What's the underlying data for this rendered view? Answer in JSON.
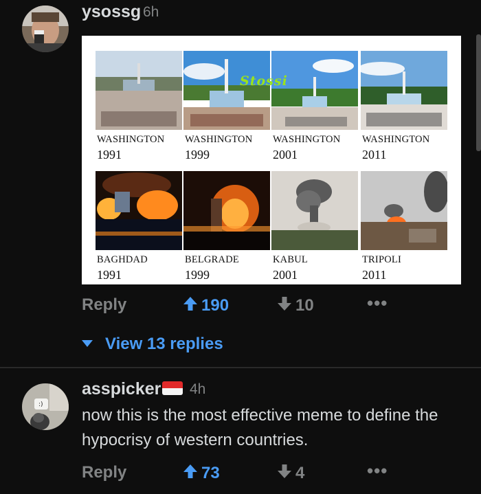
{
  "comments": [
    {
      "username": "ysossg",
      "time": "6h",
      "image": {
        "watermark": "Stossi",
        "cells": [
          {
            "city": "WASHINGTON",
            "year": "1991"
          },
          {
            "city": "WASHINGTON",
            "year": "1999"
          },
          {
            "city": "WASHINGTON",
            "year": "2001"
          },
          {
            "city": "WASHINGTON",
            "year": "2011"
          },
          {
            "city": "BAGHDAD",
            "year": "1991"
          },
          {
            "city": "BELGRADE",
            "year": "1999"
          },
          {
            "city": "KABUL",
            "year": "2001"
          },
          {
            "city": "TRIPOLI",
            "year": "2011"
          }
        ]
      },
      "reply_label": "Reply",
      "upvotes": "190",
      "downvotes": "10",
      "more": "•••",
      "view_replies": "View 13 replies"
    },
    {
      "username": "asspicker",
      "time": "4h",
      "flag": "indonesia-flag",
      "text": "now this is the most effective meme to define the hypocrisy of western countries.",
      "reply_label": "Reply",
      "upvotes": "73",
      "downvotes": "4",
      "more": "•••"
    }
  ],
  "colors": {
    "background": "#0e0e0e",
    "accent": "#4a9cf5",
    "muted": "#818384"
  }
}
